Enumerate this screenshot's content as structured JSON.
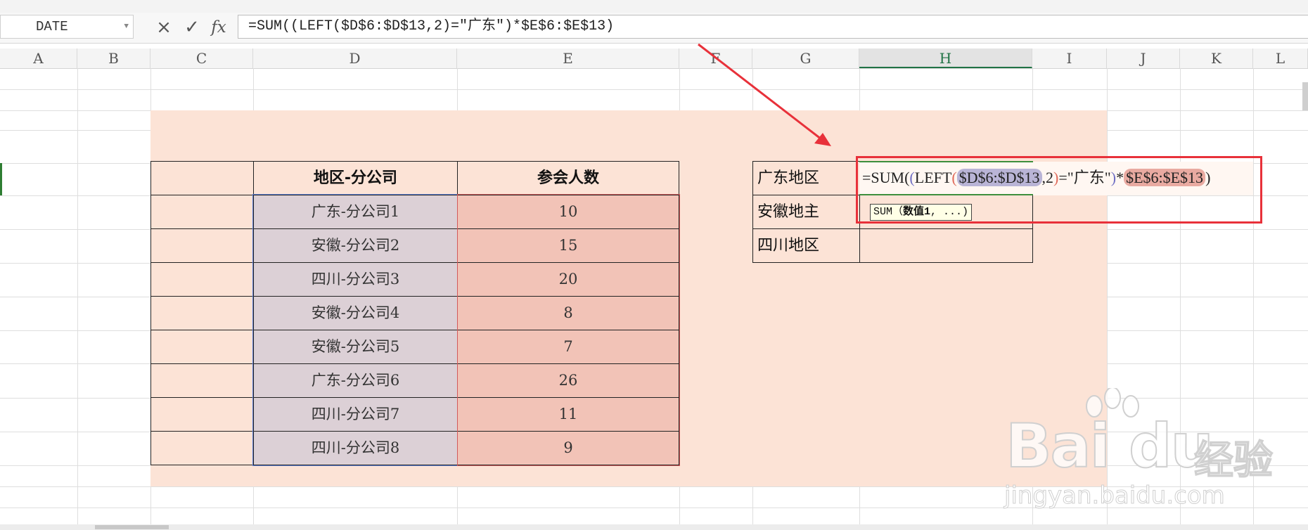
{
  "formula_bar": {
    "name_box": "DATE",
    "cancel_icon": "×",
    "confirm_icon": "✓",
    "fx_label": "fx",
    "formula": "=SUM((LEFT($D$6:$D$13,2)=\"广东\")*$E$6:$E$13)"
  },
  "columns": [
    "A",
    "B",
    "C",
    "D",
    "E",
    "F",
    "G",
    "H",
    "I",
    "J",
    "K",
    "L"
  ],
  "active_column": "H",
  "table": {
    "headers": [
      "地区-分公司",
      "参会人数"
    ],
    "rows": [
      {
        "name": "广东-分公司1",
        "count": "10"
      },
      {
        "name": "安徽-分公司2",
        "count": "15"
      },
      {
        "name": "四川-分公司3",
        "count": "20"
      },
      {
        "name": "安徽-分公司4",
        "count": "8"
      },
      {
        "name": "安徽-分公司5",
        "count": "7"
      },
      {
        "name": "广东-分公司6",
        "count": "26"
      },
      {
        "name": "四川-分公司7",
        "count": "11"
      },
      {
        "name": "四川-分公司8",
        "count": "9"
      }
    ]
  },
  "summary": {
    "labels": [
      "广东地区",
      "安徽地主",
      "四川地区"
    ]
  },
  "edit_cell": {
    "p1": "=SUM(",
    "p2": "(",
    "p3": "LEFT",
    "p4": "(",
    "ref_d": "$D$6:$D$13",
    "p5": ",2",
    "p6": ")",
    "p7": "=\"广东\"",
    "p8": ")",
    "p9": "*",
    "ref_e": "$E$6:$E$13",
    "p10": ")"
  },
  "tooltip": {
    "func": "SUM",
    "open": "（",
    "arg": "数值1",
    "rest": ", ...)"
  },
  "watermark": {
    "brand": "Bai du",
    "cn": "经验",
    "url": "jingyan.baidu.com"
  },
  "colors": {
    "highlight_red": "#e8313a",
    "peach_bg": "#fce3d6",
    "range_d": "#dcd0d6",
    "range_e": "#f2c3b7",
    "active_green": "#217346"
  }
}
